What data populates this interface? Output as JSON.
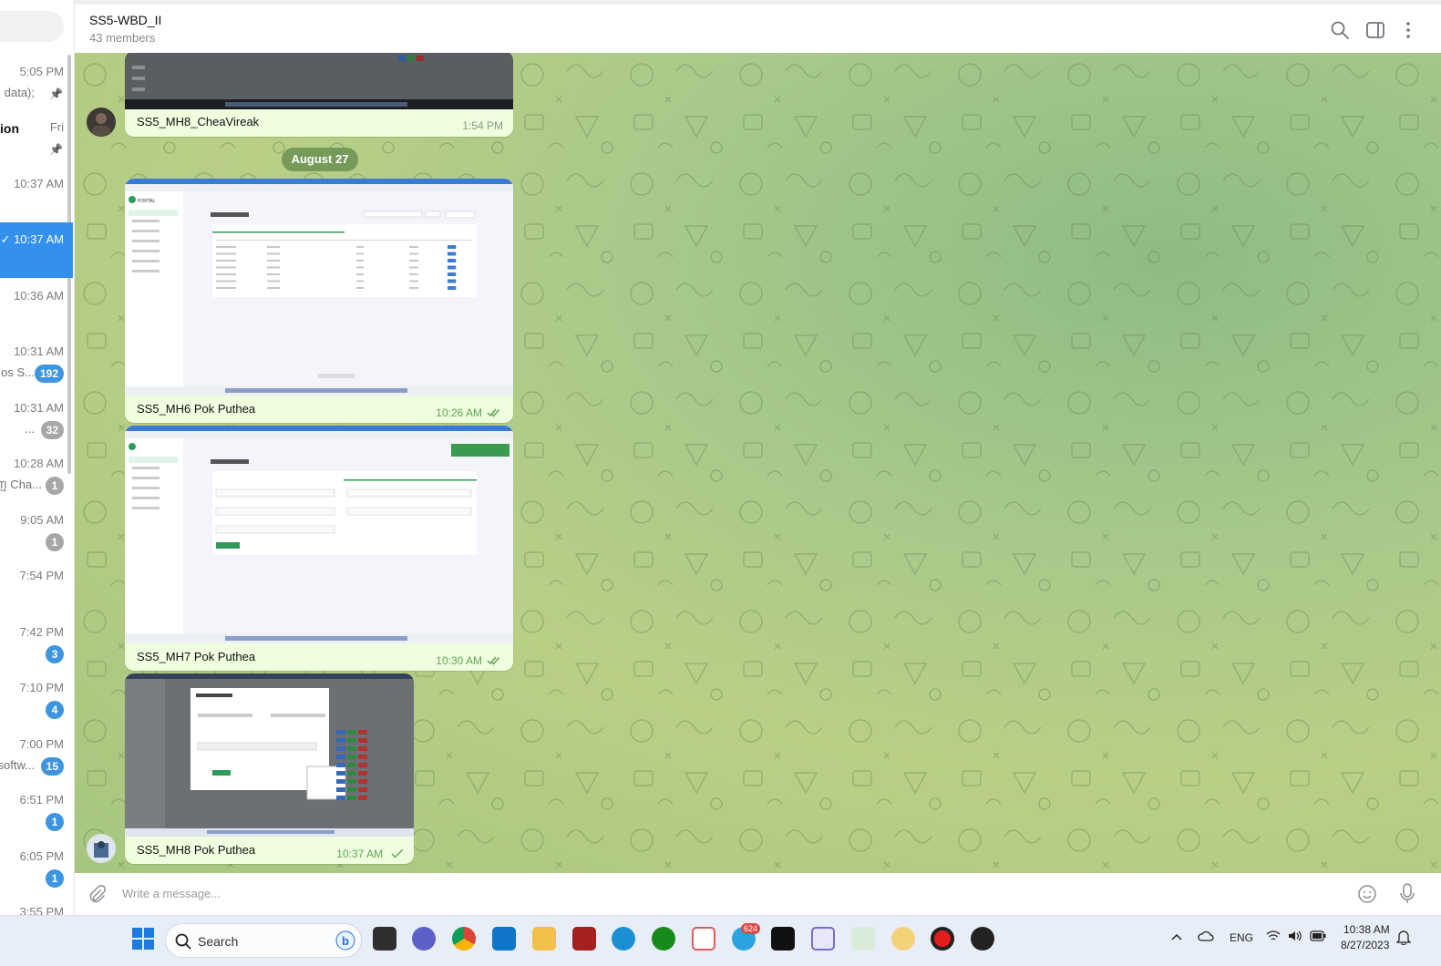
{
  "chat_list": [
    {
      "time": "5:05 PM",
      "snippet": "data);",
      "pinned": true
    },
    {
      "title": "ion",
      "time": "Fri",
      "pinned": true
    },
    {
      "time": "10:37 AM"
    },
    {
      "time": "10:37 AM",
      "active": true
    },
    {
      "time": "10:36 AM"
    },
    {
      "time": "10:31 AM",
      "snippet": "os S...",
      "badge": "192"
    },
    {
      "time": "10:31 AM",
      "snippet": "...",
      "badge": "32"
    },
    {
      "time": "10:28 AM",
      "snippet": "ញ Cha...",
      "badge": "1"
    },
    {
      "time": "9:05 AM",
      "badge": "1"
    },
    {
      "time": "7:54 PM"
    },
    {
      "time": "7:42 PM",
      "badge": "3"
    },
    {
      "time": "7:10 PM",
      "badge": "4"
    },
    {
      "time": "7:00 PM",
      "snippet": "softw...",
      "badge": "15"
    },
    {
      "time": "6:51 PM",
      "badge": "1"
    },
    {
      "time": "6:05 PM",
      "badge": "1"
    },
    {
      "time": "3:55 PM"
    }
  ],
  "header": {
    "group_name": "SS5-WBD_II",
    "members": "43 members",
    "icons": [
      "search-icon",
      "sidebar-toggle-icon",
      "more-vertical-icon"
    ]
  },
  "date_separator": "August 27",
  "messages": [
    {
      "sender": "SS5_MH8_CheaVireak",
      "time": "1:54 PM",
      "status": "none"
    },
    {
      "sender": "SS5_MH6 Pok Puthea",
      "time": "10:26 AM",
      "status": "read"
    },
    {
      "sender": "SS5_MH7 Pok Puthea",
      "time": "10:30 AM",
      "status": "read"
    },
    {
      "sender": "SS5_MH8 Pok Puthea",
      "time": "10:37 AM",
      "status": "sent"
    }
  ],
  "screenshot_text": {
    "portal": "PORTAL",
    "search": "Search",
    "download": "Download CSV",
    "menu": [
      "Overview",
      "Users",
      "Products",
      "Orders",
      "Invoices",
      "Charts",
      "Help"
    ]
  },
  "composer": {
    "placeholder": "Write a message...",
    "icons": [
      "attach-icon",
      "emoji-icon",
      "mic-icon"
    ]
  },
  "taskbar": {
    "search_label": "Search",
    "telegram_badge": "624",
    "language": "ENG",
    "clock_time": "10:38 AM",
    "clock_date": "8/27/2023"
  }
}
